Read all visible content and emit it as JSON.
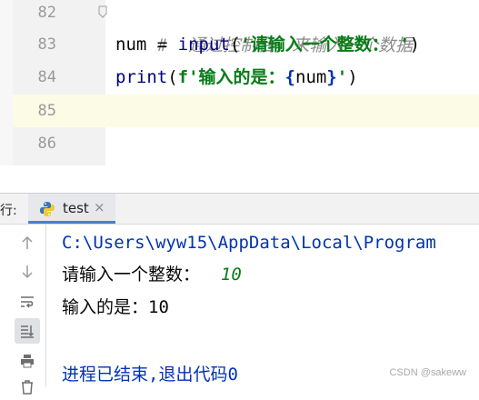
{
  "editor": {
    "lines": [
      {
        "number": "82",
        "comment": "#  通过控制台，来输入一个数据"
      },
      {
        "number": "83",
        "code_var": "num",
        "code_op": " = ",
        "code_fn": "input",
        "code_open": "(",
        "code_str": "'请输入一个整数： '",
        "code_close": ")"
      },
      {
        "number": "84",
        "code_fn": "print",
        "code_open": "(",
        "code_fprefix": "f'输入的是：",
        "code_brace_open": "{",
        "code_var": "num",
        "code_brace_close": "}",
        "code_str_end": "'",
        "code_close": ")"
      },
      {
        "number": "85"
      },
      {
        "number": "86"
      }
    ]
  },
  "run_panel": {
    "label": "行:",
    "tab": {
      "label": "test",
      "close": "×",
      "icon": "python-icon"
    },
    "tools": [
      "arrow-up-icon",
      "arrow-down-icon",
      "soft-wrap-icon",
      "scroll-to-end-icon",
      "print-icon",
      "trash-icon"
    ],
    "output": {
      "path": "C:\\Users\\wyw15\\AppData\\Local\\Program",
      "prompt": "请输入一个整数：  ",
      "input_value": "10",
      "result": "输入的是：10",
      "exit": "进程已结束,退出代码0"
    }
  },
  "watermark": "CSDN @sakeww",
  "colors": {
    "accent": "#4083c9",
    "string_green": "#067d17",
    "keyword_blue": "#0033b3",
    "current_line": "#fcfbe6"
  }
}
